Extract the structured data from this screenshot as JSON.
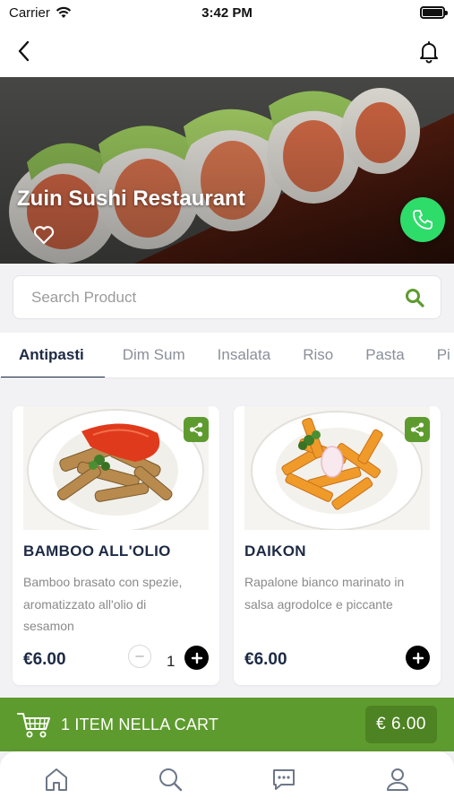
{
  "status_bar": {
    "carrier": "Carrier",
    "time": "3:42 PM"
  },
  "restaurant": {
    "name": "Zuin Sushi Restaurant"
  },
  "search": {
    "placeholder": "Search Product"
  },
  "tabs": [
    {
      "label": "Antipasti",
      "active": true
    },
    {
      "label": "Dim Sum",
      "active": false
    },
    {
      "label": "Insalata",
      "active": false
    },
    {
      "label": "Riso",
      "active": false
    },
    {
      "label": "Pasta",
      "active": false
    },
    {
      "label": "Pi",
      "active": false
    }
  ],
  "products": [
    {
      "title": "BAMBOO ALL'OLIO",
      "description": "Bamboo brasato con spezie, aromatizzato all'olio di sesamon",
      "price": "€6.00",
      "quantity": "1"
    },
    {
      "title": "DAIKON",
      "description": "Rapalone bianco marinato in salsa agrodolce e piccante",
      "price": "€6.00"
    }
  ],
  "cart": {
    "summary": "1 ITEM  NELLA CART",
    "total": "€ 6.00"
  },
  "icons": {
    "back": "chevron-left-icon",
    "bell": "bell-icon",
    "heart": "heart-icon",
    "phone": "phone-icon",
    "search": "search-icon",
    "share": "share-icon",
    "cart": "cart-icon",
    "nav": [
      "home-icon",
      "search-icon",
      "chat-icon",
      "user-icon"
    ]
  },
  "colors": {
    "accent_green": "#5e9b2e",
    "call_green": "#2edc6a",
    "title_navy": "#1d2a44"
  }
}
